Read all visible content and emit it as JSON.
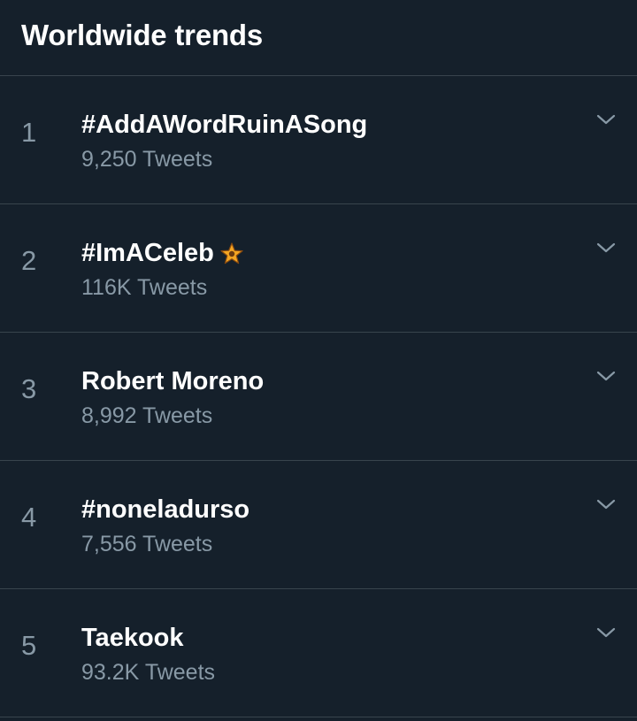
{
  "header": {
    "title": "Worldwide trends"
  },
  "trends": [
    {
      "rank": "1",
      "name": "#AddAWordRuinASong",
      "count": "9,250 Tweets",
      "icon": ""
    },
    {
      "rank": "2",
      "name": "#ImACeleb",
      "count": "116K Tweets",
      "icon": "star-emoji-icon"
    },
    {
      "rank": "3",
      "name": "Robert Moreno",
      "count": "8,992 Tweets",
      "icon": ""
    },
    {
      "rank": "4",
      "name": "#noneladurso",
      "count": "7,556 Tweets",
      "icon": ""
    },
    {
      "rank": "5",
      "name": "Taekook",
      "count": "93.2K Tweets",
      "icon": ""
    }
  ],
  "colors": {
    "background": "#15202b",
    "divider": "#38444d",
    "primary_text": "#ffffff",
    "secondary_text": "#8899a6",
    "star": "#f5a623"
  }
}
